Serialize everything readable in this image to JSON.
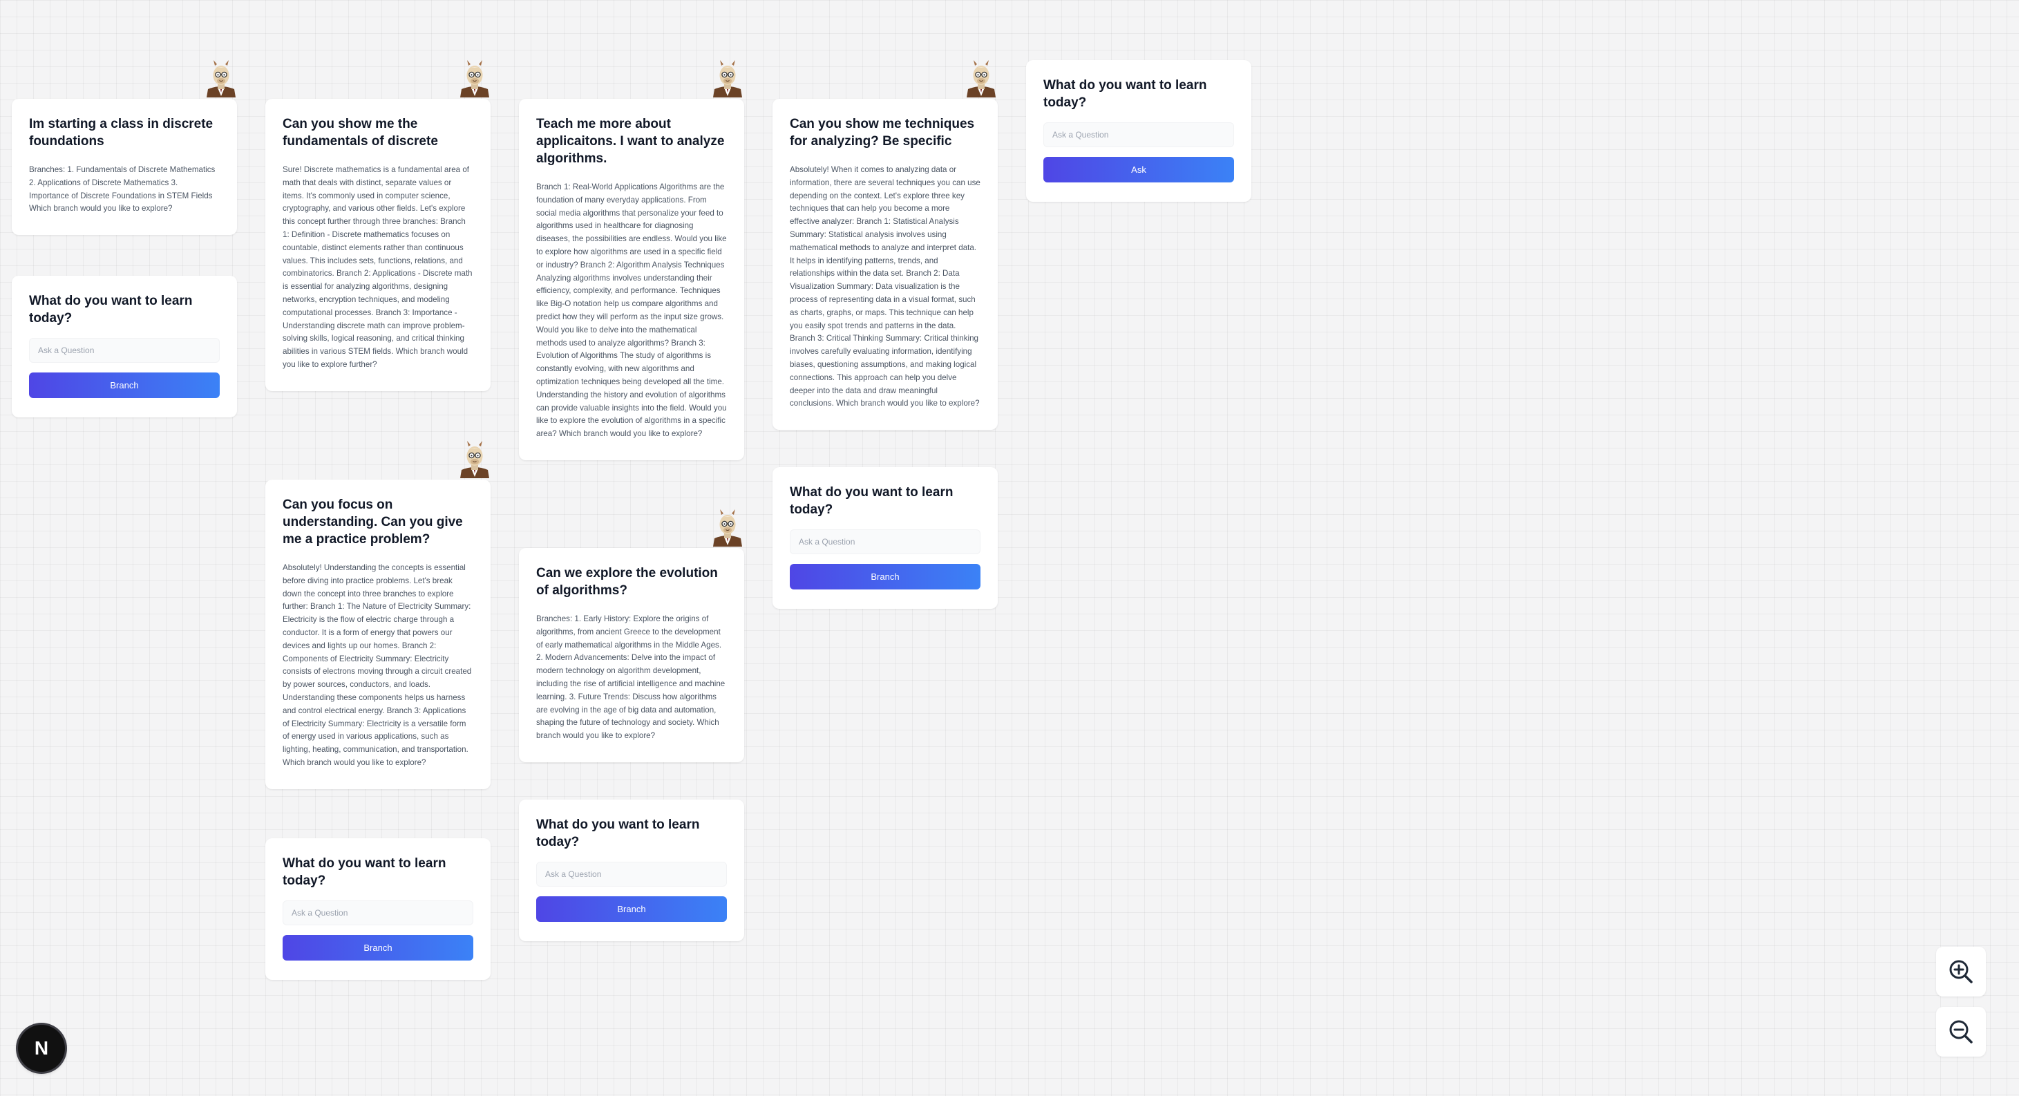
{
  "cards": [
    {
      "question": "Im starting a class in discrete foundations",
      "answer": "Branches: 1. Fundamentals of Discrete Mathematics 2. Applications of Discrete Mathematics 3. Importance of Discrete Foundations in STEM Fields Which branch would you like to explore?"
    },
    {
      "question": "Can you show me the fundamentals of discrete",
      "answer": "Sure! Discrete mathematics is a fundamental area of math that deals with distinct, separate values or items. It's commonly used in computer science, cryptography, and various other fields. Let's explore this concept further through three branches: Branch 1: Definition - Discrete mathematics focuses on countable, distinct elements rather than continuous values. This includes sets, functions, relations, and combinatorics. Branch 2: Applications - Discrete math is essential for analyzing algorithms, designing networks, encryption techniques, and modeling computational processes. Branch 3: Importance - Understanding discrete math can improve problem-solving skills, logical reasoning, and critical thinking abilities in various STEM fields. Which branch would you like to explore further?"
    },
    {
      "question": "Teach me more about applicaitons. I want to analyze algorithms.",
      "answer": "Branch 1: Real-World Applications Algorithms are the foundation of many everyday applications. From social media algorithms that personalize your feed to algorithms used in healthcare for diagnosing diseases, the possibilities are endless. Would you like to explore how algorithms are used in a specific field or industry? Branch 2: Algorithm Analysis Techniques Analyzing algorithms involves understanding their efficiency, complexity, and performance. Techniques like Big-O notation help us compare algorithms and predict how they will perform as the input size grows. Would you like to delve into the mathematical methods used to analyze algorithms? Branch 3: Evolution of Algorithms The study of algorithms is constantly evolving, with new algorithms and optimization techniques being developed all the time. Understanding the history and evolution of algorithms can provide valuable insights into the field. Would you like to explore the evolution of algorithms in a specific area? Which branch would you like to explore?"
    },
    {
      "question": "Can you show me techniques for analyzing? Be specific",
      "answer": "Absolutely! When it comes to analyzing data or information, there are several techniques you can use depending on the context. Let's explore three key techniques that can help you become a more effective analyzer: Branch 1: Statistical Analysis Summary: Statistical analysis involves using mathematical methods to analyze and interpret data. It helps in identifying patterns, trends, and relationships within the data set. Branch 2: Data Visualization Summary: Data visualization is the process of representing data in a visual format, such as charts, graphs, or maps. This technique can help you easily spot trends and patterns in the data. Branch 3: Critical Thinking Summary: Critical thinking involves carefully evaluating information, identifying biases, questioning assumptions, and making logical connections. This approach can help you delve deeper into the data and draw meaningful conclusions. Which branch would you like to explore?"
    },
    {
      "question": "Can you focus on understanding. Can you give me a practice problem?",
      "answer": "Absolutely! Understanding the concepts is essential before diving into practice problems. Let's break down the concept into three branches to explore further: Branch 1: The Nature of Electricity Summary: Electricity is the flow of electric charge through a conductor. It is a form of energy that powers our devices and lights up our homes. Branch 2: Components of Electricity Summary: Electricity consists of electrons moving through a circuit created by power sources, conductors, and loads. Understanding these components helps us harness and control electrical energy. Branch 3: Applications of Electricity Summary: Electricity is a versatile form of energy used in various applications, such as lighting, heating, communication, and transportation. Which branch would you like to explore?"
    },
    {
      "question": "Can we explore the evolution of algorithms?",
      "answer": "Branches: 1. Early History: Explore the origins of algorithms, from ancient Greece to the development of early mathematical algorithms in the Middle Ages. 2. Modern Advancements: Delve into the impact of modern technology on algorithm development, including the rise of artificial intelligence and machine learning. 3. Future Trends: Discuss how algorithms are evolving in the age of big data and automation, shaping the future of technology and society. Which branch would you like to explore?"
    }
  ],
  "ask_cards": [
    {
      "title": "What do you want to learn today?",
      "placeholder": "Ask a Question",
      "button": "Branch"
    },
    {
      "title": "What do you want to learn today?",
      "placeholder": "Ask a Question",
      "button": "Branch"
    },
    {
      "title": "What do you want to learn today?",
      "placeholder": "Ask a Question",
      "button": "Branch"
    },
    {
      "title": "What do you want to learn today?",
      "placeholder": "Ask a Question",
      "button": "Branch"
    },
    {
      "title": "What do you want to learn today?",
      "placeholder": "Ask a Question",
      "button": "Ask"
    }
  ],
  "icons": {
    "avatar": "llama-professor-icon",
    "zoom_in": "zoom-in-icon",
    "zoom_out": "zoom-out-icon",
    "framework_badge": "N"
  },
  "colors": {
    "button_gradient_start": "#4f46e5",
    "button_gradient_end": "#3b82f6",
    "canvas_background": "#f4f4f5"
  }
}
